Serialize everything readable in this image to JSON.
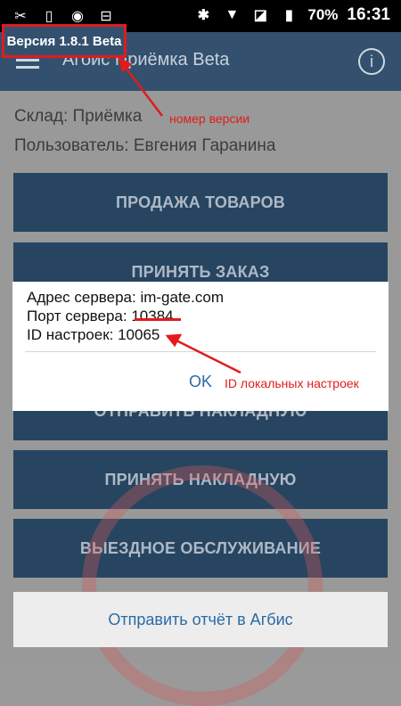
{
  "status_bar": {
    "battery": "70%",
    "time": "16:31"
  },
  "app_bar": {
    "title": "Агбис Приёмка Beta",
    "version": "Версия 1.8.1 Beta"
  },
  "info": {
    "warehouse": "Склад: Приёмка",
    "user": "Пользователь: Евгения Гаранина"
  },
  "menu_buttons": [
    "ПРОДАЖА ТОВАРОВ",
    "ПРИНЯТЬ ЗАКАЗ",
    "ОТПРАВИТЬ НАКЛАДНУЮ",
    "ПРИНЯТЬ НАКЛАДНУЮ",
    "ВЫЕЗДНОЕ ОБСЛУЖИВАНИЕ"
  ],
  "report_button": "Отправить отчёт в Агбис",
  "dialog": {
    "server_address": "Адрес сервера: im-gate.com",
    "server_port_label": "Порт сервера: ",
    "server_port_value": "10384",
    "settings_id": "ID настроек: 10065",
    "ok_label": "OK"
  },
  "annotations": {
    "version_note": "номер версии",
    "settings_note": "ID локальных настроек"
  },
  "colors": {
    "appbar": "#33516e",
    "button": "#274560",
    "annotation": "#e21b1b",
    "link": "#2c6aa6"
  }
}
